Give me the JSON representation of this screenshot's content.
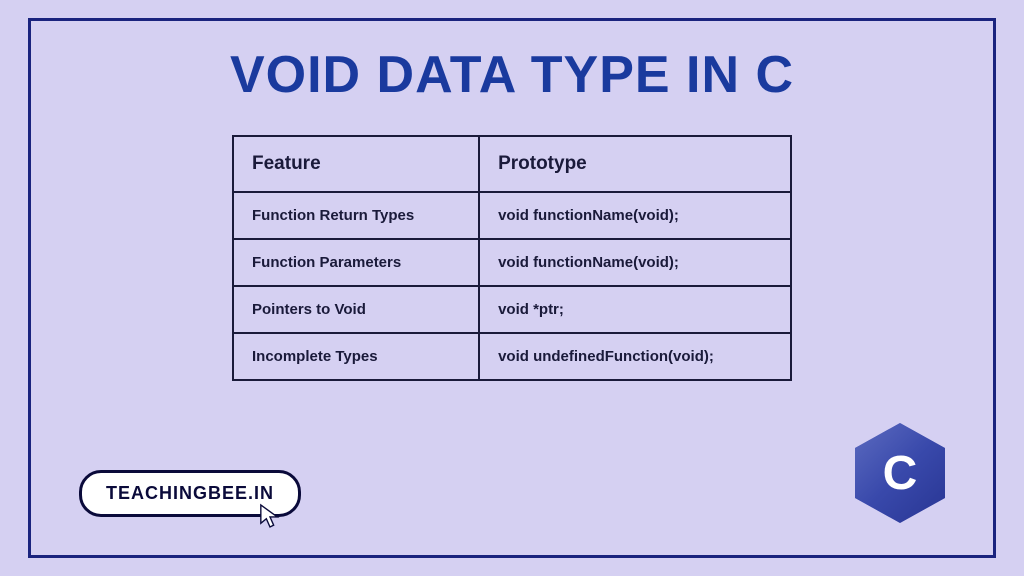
{
  "title": "VOID DATA TYPE IN C",
  "table": {
    "headers": [
      "Feature",
      "Prototype"
    ],
    "rows": [
      {
        "feature": "Function Return Types",
        "prototype": "void functionName(void);"
      },
      {
        "feature": "Function Parameters",
        "prototype": "void functionName(void);"
      },
      {
        "feature": "Pointers to Void",
        "prototype": "void *ptr;"
      },
      {
        "feature": "Incomplete Types",
        "prototype": "void undefinedFunction(void);"
      }
    ]
  },
  "badge": "TEACHINGBEE.IN",
  "logo_letter": "C",
  "chart_data": {
    "type": "table",
    "title": "Void Data Type in C",
    "columns": [
      "Feature",
      "Prototype"
    ],
    "rows": [
      [
        "Function Return Types",
        "void functionName(void);"
      ],
      [
        "Function Parameters",
        "void functionName(void);"
      ],
      [
        "Pointers to Void",
        "void *ptr;"
      ],
      [
        "Incomplete Types",
        "void undefinedFunction(void);"
      ]
    ]
  }
}
